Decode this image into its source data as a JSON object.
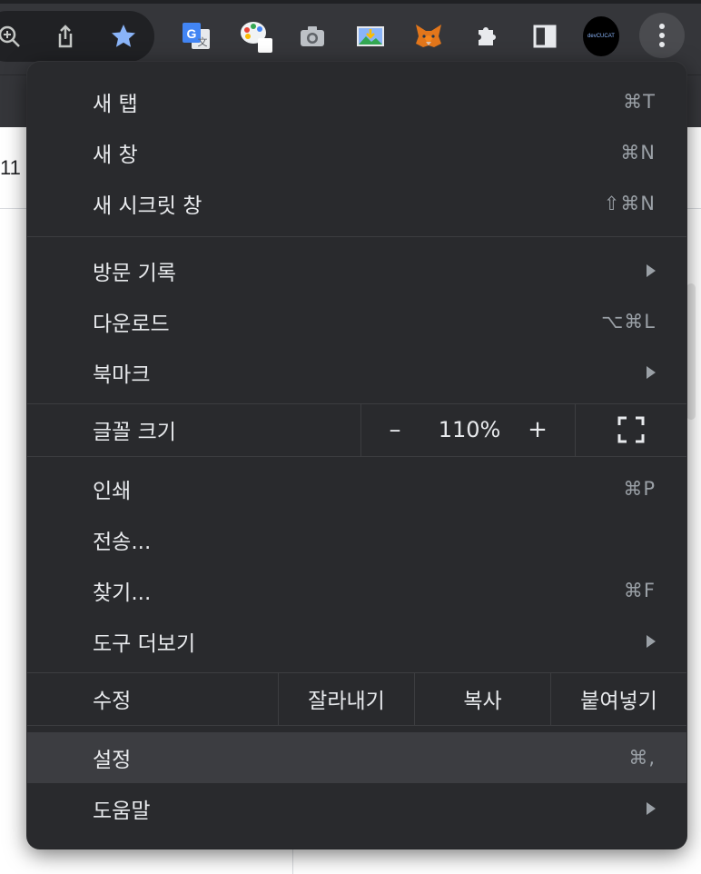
{
  "page": {
    "partial_text": "11"
  },
  "toolbar": {
    "icons": [
      "zoom-icon",
      "share-icon",
      "bookmark-star-icon",
      "google-translate-icon",
      "palette-extension-icon",
      "camera-extension-icon",
      "image-download-extension-icon",
      "metamask-fox-icon",
      "extensions-puzzle-icon",
      "side-panel-icon",
      "devcucat-avatar-icon",
      "more-menu-icon"
    ],
    "avatar_text": "devCUCAT",
    "star_color": "#8ab4f8"
  },
  "menu": {
    "section1": [
      {
        "label": "새 탭",
        "shortcut": "⌘T"
      },
      {
        "label": "새 창",
        "shortcut": "⌘N"
      },
      {
        "label": "새 시크릿 창",
        "shortcut": "⇧⌘N"
      }
    ],
    "section2": [
      {
        "label": "방문 기록",
        "submenu": true
      },
      {
        "label": "다운로드",
        "shortcut": "⌥⌘L"
      },
      {
        "label": "북마크",
        "submenu": true
      }
    ],
    "zoom": {
      "label": "글꼴 크기",
      "minus": "–",
      "value": "110%",
      "plus": "+"
    },
    "section3": [
      {
        "label": "인쇄",
        "shortcut": "⌘P"
      },
      {
        "label": "전송..."
      },
      {
        "label": "찾기...",
        "shortcut": "⌘F"
      },
      {
        "label": "도구 더보기",
        "submenu": true
      }
    ],
    "edit": {
      "label": "수정",
      "cut": "잘라내기",
      "copy": "복사",
      "paste": "붙여넣기"
    },
    "section4": [
      {
        "label": "설정",
        "shortcut": "⌘,",
        "highlighted": true
      },
      {
        "label": "도움말",
        "submenu": true
      }
    ]
  }
}
